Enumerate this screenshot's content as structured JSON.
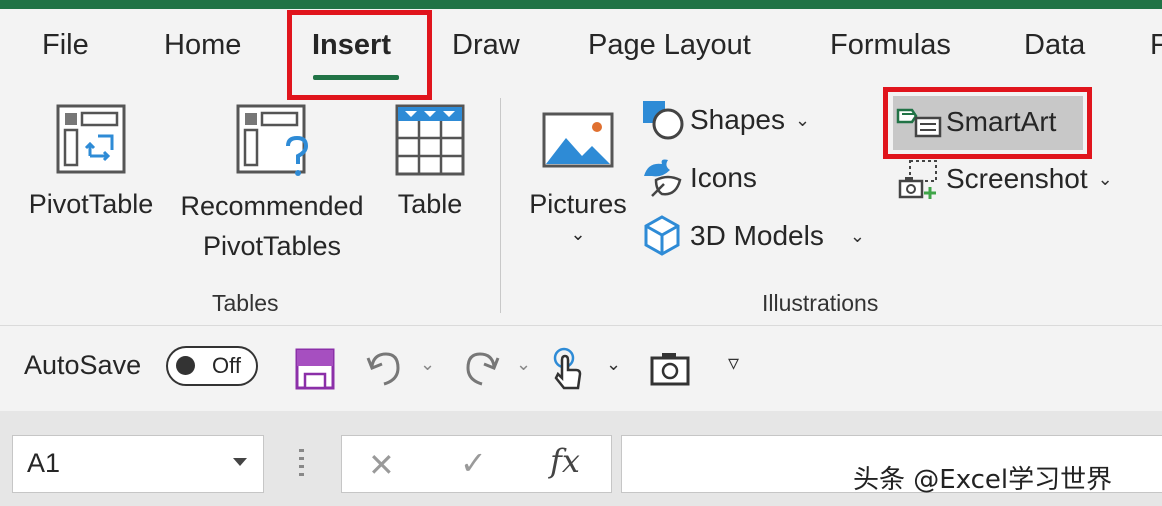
{
  "tabs": [
    "File",
    "Home",
    "Insert",
    "Draw",
    "Page Layout",
    "Formulas",
    "Data",
    "F"
  ],
  "active_tab": "Insert",
  "ribbon": {
    "tables": {
      "pivottable_label": "PivotTable",
      "recommended_line1": "Recommended",
      "recommended_line2": "PivotTables",
      "table_label": "Table",
      "group_label": "Tables"
    },
    "illustrations": {
      "pictures_label": "Pictures",
      "shapes_label": "Shapes",
      "icons_label": "Icons",
      "models_label": "3D Models",
      "smartart_label": "SmartArt",
      "screenshot_label": "Screenshot",
      "group_label": "Illustrations"
    }
  },
  "qat": {
    "autosave_label": "AutoSave",
    "toggle_state": "Off"
  },
  "formula_bar": {
    "name_box_value": "A1",
    "fx_label": "fx"
  },
  "watermark": "头条 @Excel学习世界",
  "colors": {
    "accent_green": "#217346",
    "highlight_red": "#e0141c",
    "icon_blue": "#2e8bd6",
    "save_purple": "#8b2fa8"
  }
}
